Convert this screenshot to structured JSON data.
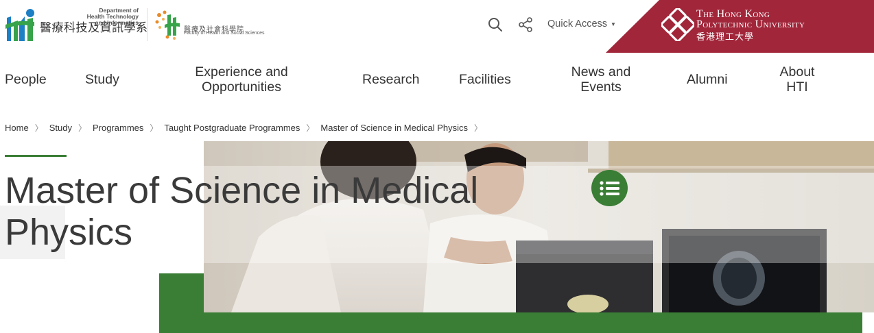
{
  "header": {
    "dept_name_cn": "醫療科技及資訊學系",
    "dept_name_en": [
      "Department of",
      "Health Technology",
      "and Informatics"
    ],
    "faculty_name_cn": "醫療及社會科學院",
    "faculty_name_en": "Faculty of Health and Social Sciences",
    "quick_access_label": "Quick Access",
    "university_name_en_line1": "The Hong Kong",
    "university_name_en_line2": "Polytechnic University",
    "university_name_cn": "香港理工大學",
    "icons": {
      "search": "search-icon",
      "share": "share-icon",
      "caret": "caret-down-icon"
    }
  },
  "nav": {
    "items": [
      {
        "label": "People"
      },
      {
        "label": "Study"
      },
      {
        "label_line1": "Experience and",
        "label_line2": "Opportunities"
      },
      {
        "label": "Research"
      },
      {
        "label": "Facilities"
      },
      {
        "label_line1": "News and",
        "label_line2": "Events"
      },
      {
        "label": "Alumni"
      },
      {
        "label_line1": "About",
        "label_line2": "HTI"
      }
    ]
  },
  "breadcrumb": [
    "Home",
    "Study",
    "Programmes",
    "Taught Postgraduate Programmes",
    "Master of Science in Medical Physics"
  ],
  "hero": {
    "title_line1": "Master of Science in Medical",
    "title_line2": "Physics",
    "menu_icon": "list-icon"
  },
  "colors": {
    "brand_green": "#3a7d35",
    "polyu_red": "#a1263a",
    "text": "#333333"
  }
}
